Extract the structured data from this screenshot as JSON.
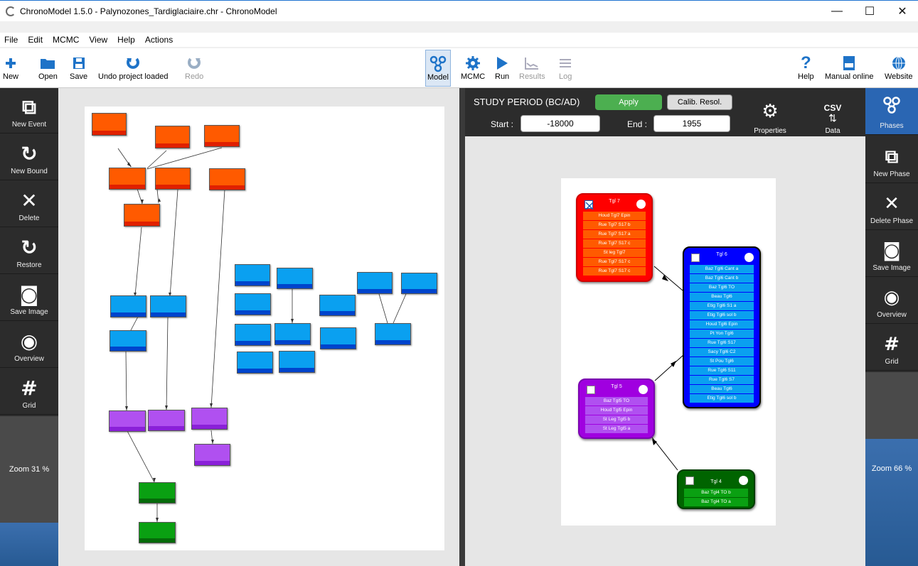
{
  "window": {
    "title": "ChronoModel 1.5.0 - Palynozones_Tardiglaciaire.chr - ChronoModel",
    "minimize": "—",
    "maximize": "☐",
    "close": "✕"
  },
  "menu": [
    "File",
    "Edit",
    "MCMC",
    "View",
    "Help",
    "Actions"
  ],
  "toolbar": {
    "new": "New",
    "open": "Open",
    "save": "Save",
    "undo": "Undo project loaded",
    "redo": "Redo",
    "model": "Model",
    "mcmc": "MCMC",
    "run": "Run",
    "results": "Results",
    "log": "Log",
    "help": "Help",
    "manual": "Manual online",
    "website": "Website"
  },
  "left_sidebar": {
    "new_event": "New Event",
    "new_bound": "New Bound",
    "delete": "Delete",
    "restore": "Restore",
    "save_image": "Save Image",
    "overview": "Overview",
    "grid": "Grid",
    "zoom": "Zoom 31 %"
  },
  "study": {
    "title": "STUDY PERIOD (BC/AD)",
    "apply": "Apply",
    "calib": "Calib. Resol.",
    "start_label": "Start :",
    "start_value": "-18000",
    "end_label": "End :",
    "end_value": "1955",
    "properties": "Properties",
    "csv": "CSV",
    "data": "Data",
    "phases": "Phases"
  },
  "right_sidebar": {
    "new_phase": "New Phase",
    "delete_phase": "Delete Phase",
    "save_image": "Save Image",
    "overview": "Overview",
    "grid": "Grid",
    "zoom": "Zoom 66 %"
  },
  "phases": [
    {
      "id": "tgl7",
      "name": "Tgl 7",
      "color": "#ff0000",
      "checked": true,
      "events": [
        "Houd Tgl7 Epin",
        "Rue Tgl7 S17 b",
        "Rue Tgl7 S17 a",
        "Rue Tgl7 S17 c",
        "St leg Tgl7",
        "Rue Tgl7 S17 c",
        "Rue Tgl7 S17 c"
      ]
    },
    {
      "id": "tgl6",
      "name": "Tgl 6",
      "color": "#0000ff",
      "checked": false,
      "events": [
        "Baz Tgl6 Cant a",
        "Baz Tgl6 Cant b",
        "Baz Tgl6 TO",
        "Beau Tgl6",
        "Etig Tgl6 S1 a",
        "Etig Tgl6 sol b",
        "Houd Tgl6 Epin",
        "Pt Yon Tgl6",
        "Rue Tgl6 S17",
        "Sacy Tgl6 C2",
        "St Pou Tgl6",
        "Rue Tgl6 S11",
        "Rue Tgl6 S7",
        "Beau Tgl6",
        "Etig Tgl6 sol b"
      ]
    },
    {
      "id": "tgl5",
      "name": "Tgl 5",
      "color": "#a000e0",
      "checked": false,
      "events": [
        "Baz Tgl5 TO",
        "Houd Tgl5 Epin",
        "St Leg Tgl5 b",
        "St Leg Tgl5 a"
      ]
    },
    {
      "id": "tgl4",
      "name": "Tgl 4",
      "color": "#006400",
      "checked": false,
      "events": [
        "Baz Tgl4 TO b",
        "Baz Tgl4 TO a"
      ]
    }
  ]
}
